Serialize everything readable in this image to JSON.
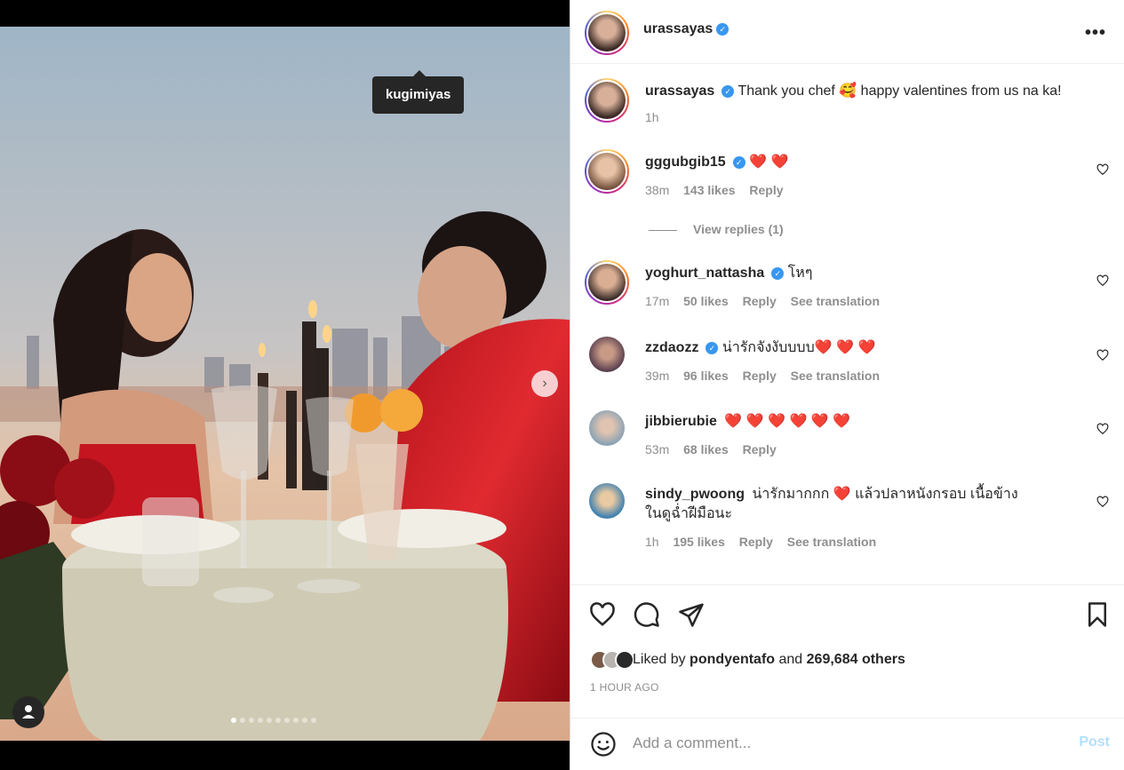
{
  "media": {
    "tag_label": "kugimiyas",
    "carousel": {
      "count": 10,
      "active_index": 0
    }
  },
  "post": {
    "author": "urassayas",
    "caption_user": "urassayas",
    "caption_text": "Thank you chef 🥰 happy valentines from us na ka!",
    "caption_time": "1h"
  },
  "comments": [
    {
      "user": "gggubgib15",
      "verified": true,
      "text": "❤️ ❤️",
      "time": "38m",
      "likes": "143 likes",
      "reply": "Reply",
      "translate": ""
    },
    {
      "user": "yoghurt_nattasha",
      "verified": true,
      "text": "โหๆ",
      "time": "17m",
      "likes": "50 likes",
      "reply": "Reply",
      "translate": "See translation"
    },
    {
      "user": "zzdaozz",
      "verified": true,
      "text": "น่ารักจังงับบบบ❤️ ❤️ ❤️",
      "time": "39m",
      "likes": "96 likes",
      "reply": "Reply",
      "translate": "See translation"
    },
    {
      "user": "jibbierubie",
      "verified": false,
      "text": "❤️ ❤️ ❤️ ❤️ ❤️ ❤️",
      "time": "53m",
      "likes": "68 likes",
      "reply": "Reply",
      "translate": ""
    },
    {
      "user": "sindy_pwoong",
      "verified": false,
      "text": "น่ารักมากกก ❤️  แล้วปลาหนังกรอบ เนื้อข้างในดูฉ่ำฝีมือนะ",
      "time": "1h",
      "likes": "195 likes",
      "reply": "Reply",
      "translate": "See translation"
    }
  ],
  "view_replies": "View replies (1)",
  "likes": {
    "prefix": "Liked by",
    "user": "pondyentafo",
    "joiner": "and",
    "others": "269,684 others"
  },
  "timestamp": "1 HOUR AGO",
  "add_comment": {
    "placeholder": "Add a comment...",
    "post_label": "Post"
  },
  "colors": {
    "accent": "#3897f0",
    "heart": "#e0245e",
    "post_disabled": "#b2dffc"
  },
  "icons": [
    "more-icon",
    "heart-icon",
    "comment-icon",
    "share-icon",
    "bookmark-icon",
    "smile-icon",
    "verified-icon",
    "chevron-right-icon",
    "user-tag-icon"
  ]
}
